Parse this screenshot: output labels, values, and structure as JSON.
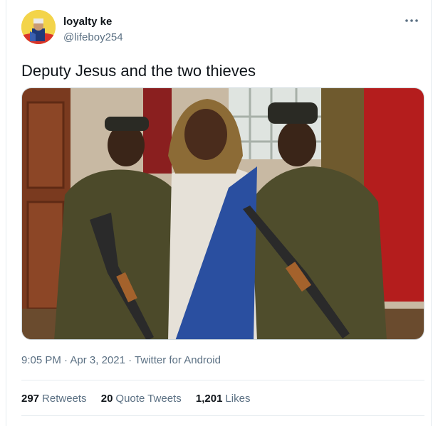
{
  "tweet": {
    "author": {
      "display_name": "loyalty ke",
      "handle": "@lifeboy254",
      "avatar_icon": "profile-avatar"
    },
    "more_icon": "more-options-icon",
    "text": "Deputy Jesus and the two thieves",
    "media": {
      "type": "photo"
    },
    "meta": {
      "time": "9:05 PM",
      "separator": "·",
      "date": "Apr 3, 2021",
      "source": "Twitter for Android"
    },
    "stats": {
      "retweets_count": "297",
      "retweets_label": "Retweets",
      "quotes_count": "20",
      "quotes_label": "Quote Tweets",
      "likes_count": "1,201",
      "likes_label": "Likes"
    }
  },
  "colors": {
    "text_primary": "#0f1419",
    "text_secondary": "#5b7083",
    "divider": "#e6ecf0"
  }
}
